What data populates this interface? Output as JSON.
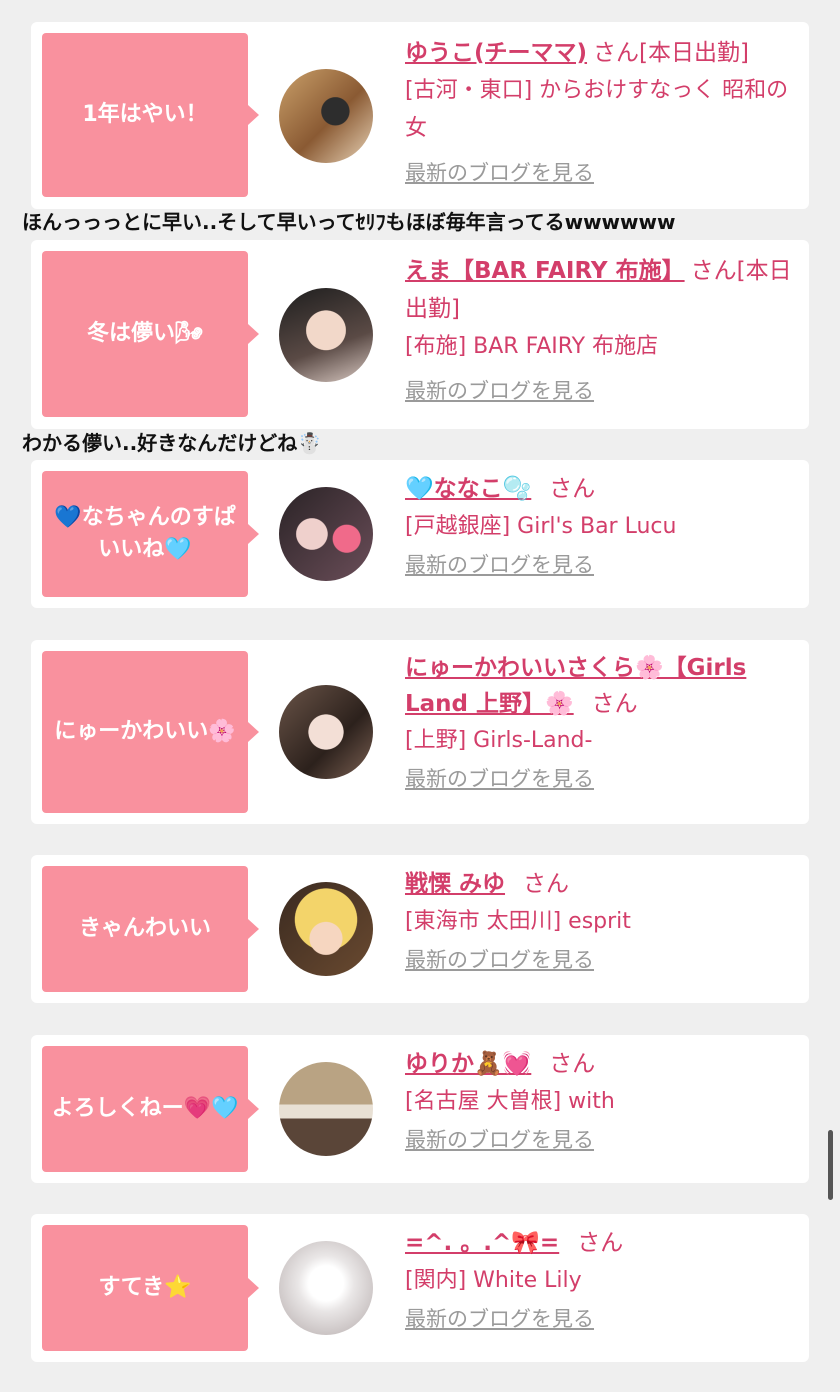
{
  "items": [
    {
      "bubble": "1年はやい！",
      "name": "ゆうこ(チーママ)",
      "san": "さん",
      "status": "[本日出勤]",
      "sub": "[古河・東口] からおけすなっく 昭和の女",
      "blog": "最新のブログを見る"
    },
    {
      "bubble": "冬は儚い🌬",
      "name": "えま【BAR FAIRY 布施】",
      "san": "さん",
      "status": "[本日出勤]",
      "sub": "[布施] BAR FAIRY 布施店",
      "blog": "最新のブログを見る"
    },
    {
      "bubble": "💙なちゃんのすぱいいね🩵",
      "name": "🩵ななこ🫧",
      "san": "さん",
      "status": "",
      "sub": "[戸越銀座] Girl's Bar Lucu",
      "blog": "最新のブログを見る"
    },
    {
      "bubble": "にゅーかわいい🌸",
      "name": "にゅーかわいいさくら🌸【Girls Land 上野】🌸",
      "san": "さん",
      "status": "",
      "sub": "[上野] Girls-Land-",
      "blog": "最新のブログを見る"
    },
    {
      "bubble": "きゃんわいい",
      "name": "戦慄 みゆ",
      "san": "さん",
      "status": "",
      "sub": "[東海市 太田川] esprit",
      "blog": "最新のブログを見る"
    },
    {
      "bubble": "よろしくねー💗🩵",
      "name": "ゆりか🧸💓",
      "san": "さん",
      "status": "",
      "sub": "[名古屋 大曽根] with",
      "blog": "最新のブログを見る"
    },
    {
      "bubble": "すてき⭐",
      "name": "=^. 。.^🎀=",
      "san": "さん",
      "status": "",
      "sub": "[関内] White Lily",
      "blog": "最新のブログを見る"
    }
  ],
  "comments": [
    "ほんっっっとに早い..そして早いってｾﾘﾌもほぼ毎年言ってるwwwwww",
    "わかる儚い..好きなんだけどね☃️"
  ]
}
